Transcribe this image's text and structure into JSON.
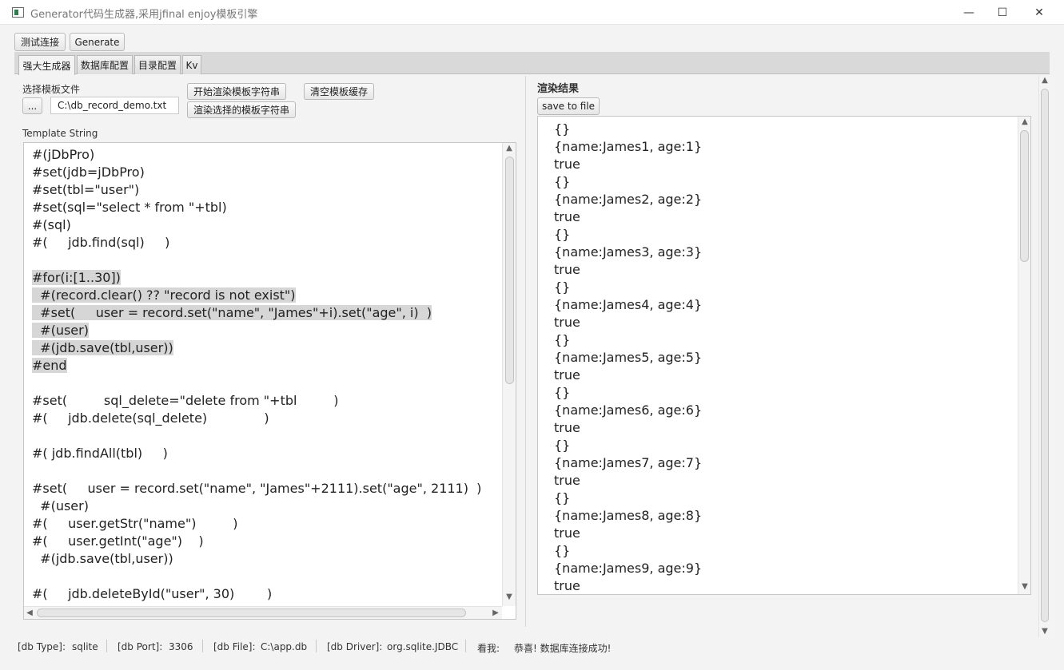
{
  "window": {
    "title": "Generator代码生成器,采用jfinal enjoy模板引擎",
    "minimize": "—",
    "maximize": "☐",
    "close": "✕"
  },
  "toolbar": {
    "test_connection": "测试连接",
    "generate": "Generate"
  },
  "tabs": [
    {
      "label": "强大生成器",
      "active": true
    },
    {
      "label": "数据库配置",
      "active": false
    },
    {
      "label": "目录配置",
      "active": false
    },
    {
      "label": "Kv",
      "active": false
    }
  ],
  "left": {
    "select_template_label": "选择模板文件",
    "browse_button": "...",
    "template_path": "C:\\db_record_demo.txt",
    "render_template_button": "开始渲染模板字符串",
    "render_selected_button": "渲染选择的模板字符串",
    "clear_cache_button": "清空模板缓存",
    "template_string_label": "Template String",
    "code_lines": [
      {
        "text": "#(jDbPro)",
        "hl": false
      },
      {
        "text": "#set(jdb=jDbPro)",
        "hl": false
      },
      {
        "text": "#set(tbl=\"user\")",
        "hl": false
      },
      {
        "text": "#set(sql=\"select * from \"+tbl)",
        "hl": false
      },
      {
        "text": "#(sql)",
        "hl": false
      },
      {
        "text": "#(     jdb.find(sql)     )",
        "hl": false
      },
      {
        "text": "",
        "hl": false
      },
      {
        "text": "#for(i:[1..30])",
        "hl": true
      },
      {
        "text": "  #(record.clear() ?? \"record is not exist\")",
        "hl": true
      },
      {
        "text": "  #set(     user = record.set(\"name\", \"James\"+i).set(\"age\", i)  )",
        "hl": true
      },
      {
        "text": "  #(user)",
        "hl": true
      },
      {
        "text": "  #(jdb.save(tbl,user))",
        "hl": true
      },
      {
        "text": "#end",
        "hl": true
      },
      {
        "text": "",
        "hl": false
      },
      {
        "text": "#set(         sql_delete=\"delete from \"+tbl         )",
        "hl": false
      },
      {
        "text": "#(     jdb.delete(sql_delete)              )",
        "hl": false
      },
      {
        "text": "",
        "hl": false
      },
      {
        "text": "#( jdb.findAll(tbl)     )",
        "hl": false
      },
      {
        "text": "",
        "hl": false
      },
      {
        "text": "#set(     user = record.set(\"name\", \"James\"+2111).set(\"age\", 2111)  )",
        "hl": false
      },
      {
        "text": "  #(user)",
        "hl": false
      },
      {
        "text": "#(     user.getStr(\"name\")         )",
        "hl": false
      },
      {
        "text": "#(     user.getInt(\"age\")    )",
        "hl": false
      },
      {
        "text": "  #(jdb.save(tbl,user))",
        "hl": false
      },
      {
        "text": "",
        "hl": false
      },
      {
        "text": "#(     jdb.deleteById(\"user\", 30)        )",
        "hl": false
      }
    ]
  },
  "right": {
    "result_label": "渲染结果",
    "save_button": "save to file",
    "result_lines": [
      "{}",
      "{name:James1, age:1}",
      "true",
      "{}",
      "{name:James2, age:2}",
      "true",
      "{}",
      "{name:James3, age:3}",
      "true",
      "{}",
      "{name:James4, age:4}",
      "true",
      "{}",
      "{name:James5, age:5}",
      "true",
      "{}",
      "{name:James6, age:6}",
      "true",
      "{}",
      "{name:James7, age:7}",
      "true",
      "{}",
      "{name:James8, age:8}",
      "true",
      "{}",
      "{name:James9, age:9}",
      "true"
    ]
  },
  "status": {
    "db_type_label": "[db Type]:",
    "db_type": "sqlite",
    "db_port_label": "[db Port]:",
    "db_port": "3306",
    "db_file_label": "[db File]:",
    "db_file": "C:\\app.db",
    "db_driver_label": "[db Driver]:",
    "db_driver": "org.sqlite.JDBC",
    "look_label": "看我:",
    "message": "恭喜! 数据库连接成功!"
  }
}
